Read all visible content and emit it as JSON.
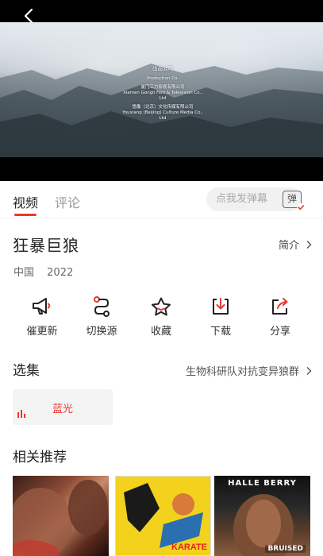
{
  "player": {
    "credits": {
      "heading": "出品公司",
      "heading_en": "Production Co.",
      "line1_cn": "厦门工力影视有限公司",
      "line1_en": "Xiamen Gongli Film & Television Co., Ltd",
      "line2_cn": "悠像（北京）文化传媒有限公司",
      "line2_en": "Youxiang (Beijing) Culture Media Co., Ltd"
    }
  },
  "tabs": {
    "video": "视频",
    "comments": "评论"
  },
  "danmu": {
    "placeholder": "点我发弹幕",
    "toggle": "弹"
  },
  "movie": {
    "title": "狂暴巨狼",
    "intro_label": "简介",
    "country": "中国",
    "year": "2022"
  },
  "actions": {
    "update": "催更新",
    "source": "切换源",
    "favorite": "收藏",
    "download": "下载",
    "share": "分享"
  },
  "episodes": {
    "heading": "选集",
    "more": "生物科研队对抗变异狼群",
    "items": [
      "蓝光"
    ]
  },
  "related": {
    "heading": "相关推荐",
    "items": [
      {
        "text": ""
      },
      {
        "text": "KARATE"
      },
      {
        "text": "HALLE BERRY",
        "sub": "BRUISED"
      }
    ]
  },
  "colors": {
    "accent": "#e8382f"
  }
}
